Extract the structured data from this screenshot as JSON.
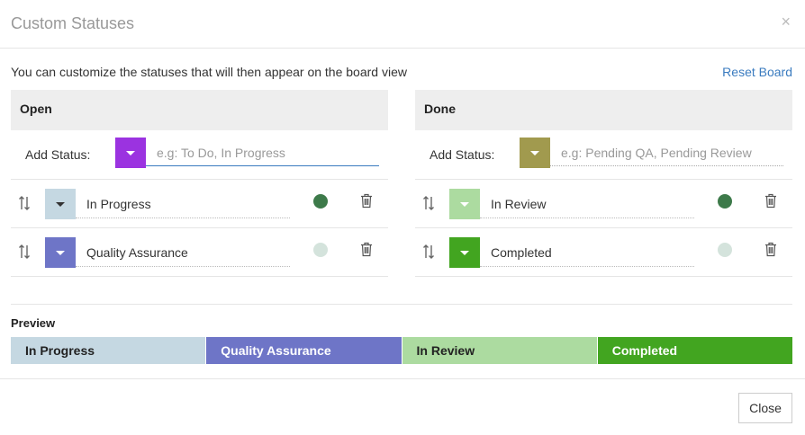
{
  "dialog": {
    "title": "Custom Statuses",
    "close_icon": "×",
    "intro": "You can customize the statuses that will then appear on the board view",
    "reset_label": "Reset Board"
  },
  "open_column": {
    "heading": "Open",
    "add_label": "Add Status:",
    "add_color": "#9b33e0",
    "add_placeholder": "e.g: To Do, In Progress",
    "statuses": [
      {
        "name": "In Progress",
        "color": "#c5d8e2",
        "dot_color": "#3d7a4a"
      },
      {
        "name": "Quality Assurance",
        "color": "#6e75c7",
        "dot_color": "#d4e3dc"
      }
    ]
  },
  "done_column": {
    "heading": "Done",
    "add_label": "Add Status:",
    "add_color": "#a19a4e",
    "add_placeholder": "e.g: Pending QA, Pending Review",
    "statuses": [
      {
        "name": "In Review",
        "color": "#acdba0",
        "dot_color": "#3d7a4a"
      },
      {
        "name": "Completed",
        "color": "#42a520",
        "dot_color": "#d4e3dc"
      }
    ]
  },
  "preview": {
    "label": "Preview",
    "segments": [
      {
        "name": "In Progress",
        "bg": "#c5d8e2",
        "fg": "#222222"
      },
      {
        "name": "Quality Assurance",
        "bg": "#6e75c7",
        "fg": "#ffffff"
      },
      {
        "name": "In Review",
        "bg": "#acdba0",
        "fg": "#222222"
      },
      {
        "name": "Completed",
        "bg": "#42a520",
        "fg": "#ffffff"
      }
    ]
  },
  "footer": {
    "close_label": "Close"
  }
}
